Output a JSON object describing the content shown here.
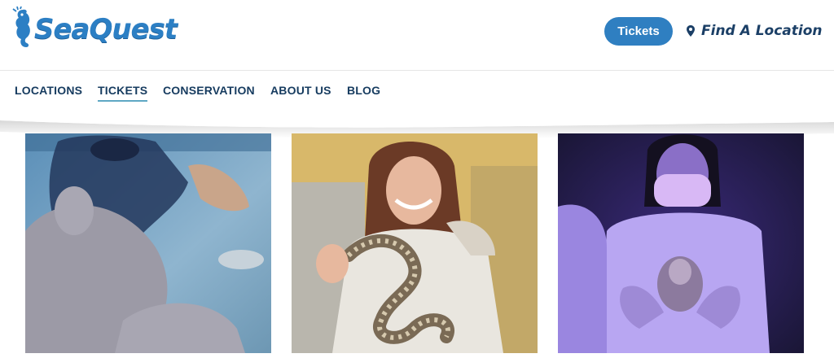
{
  "header": {
    "logo_text": "SeaQuest",
    "tickets_label": "Tickets",
    "find_location_label": "Find A Location"
  },
  "nav": {
    "items": [
      {
        "label": "LOCATIONS",
        "active": false
      },
      {
        "label": "TICKETS",
        "active": true
      },
      {
        "label": "CONSERVATION",
        "active": false
      },
      {
        "label": "ABOUT US",
        "active": false
      },
      {
        "label": "BLOG",
        "active": false
      }
    ]
  },
  "colors": {
    "brand_blue": "#2f7fc1",
    "nav_text": "#163b5f",
    "underline": "#5fa8c4"
  },
  "photos": [
    {
      "icon": "stingray-touch-photo"
    },
    {
      "icon": "woman-holding-snake-photo"
    },
    {
      "icon": "masked-person-holding-squirrel-photo"
    }
  ]
}
